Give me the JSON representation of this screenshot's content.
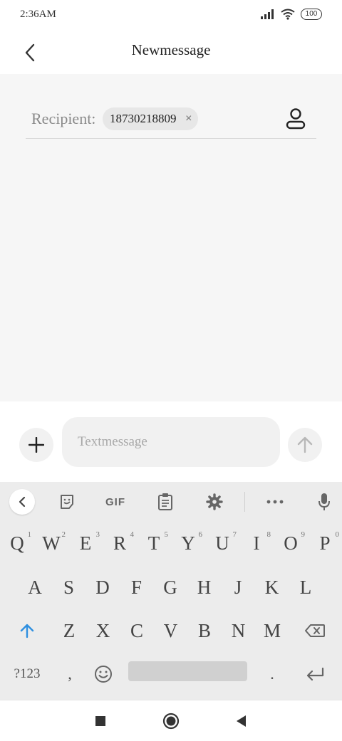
{
  "status_bar": {
    "time": "2:36AM",
    "battery": "100"
  },
  "header": {
    "title": "Newmessage",
    "back_icon": "chevron-left-icon"
  },
  "recipient": {
    "label": "Recipient:",
    "chip_value": "18730218809",
    "chip_close": "×"
  },
  "composer": {
    "placeholder": "Textmessage"
  },
  "keyboard": {
    "toolbar": {
      "gif_label": "GIF"
    },
    "row1": [
      {
        "k": "Q",
        "n": "1"
      },
      {
        "k": "W",
        "n": "2"
      },
      {
        "k": "E",
        "n": "3"
      },
      {
        "k": "R",
        "n": "4"
      },
      {
        "k": "T",
        "n": "5"
      },
      {
        "k": "Y",
        "n": "6"
      },
      {
        "k": "U",
        "n": "7"
      },
      {
        "k": "I",
        "n": "8"
      },
      {
        "k": "O",
        "n": "9"
      },
      {
        "k": "P",
        "n": "0"
      }
    ],
    "row2": [
      "A",
      "S",
      "D",
      "F",
      "G",
      "H",
      "J",
      "K",
      "L"
    ],
    "row3": [
      "Z",
      "X",
      "C",
      "V",
      "B",
      "N",
      "M"
    ],
    "row4": {
      "symbols": "?123",
      "comma": ",",
      "period": "."
    }
  }
}
